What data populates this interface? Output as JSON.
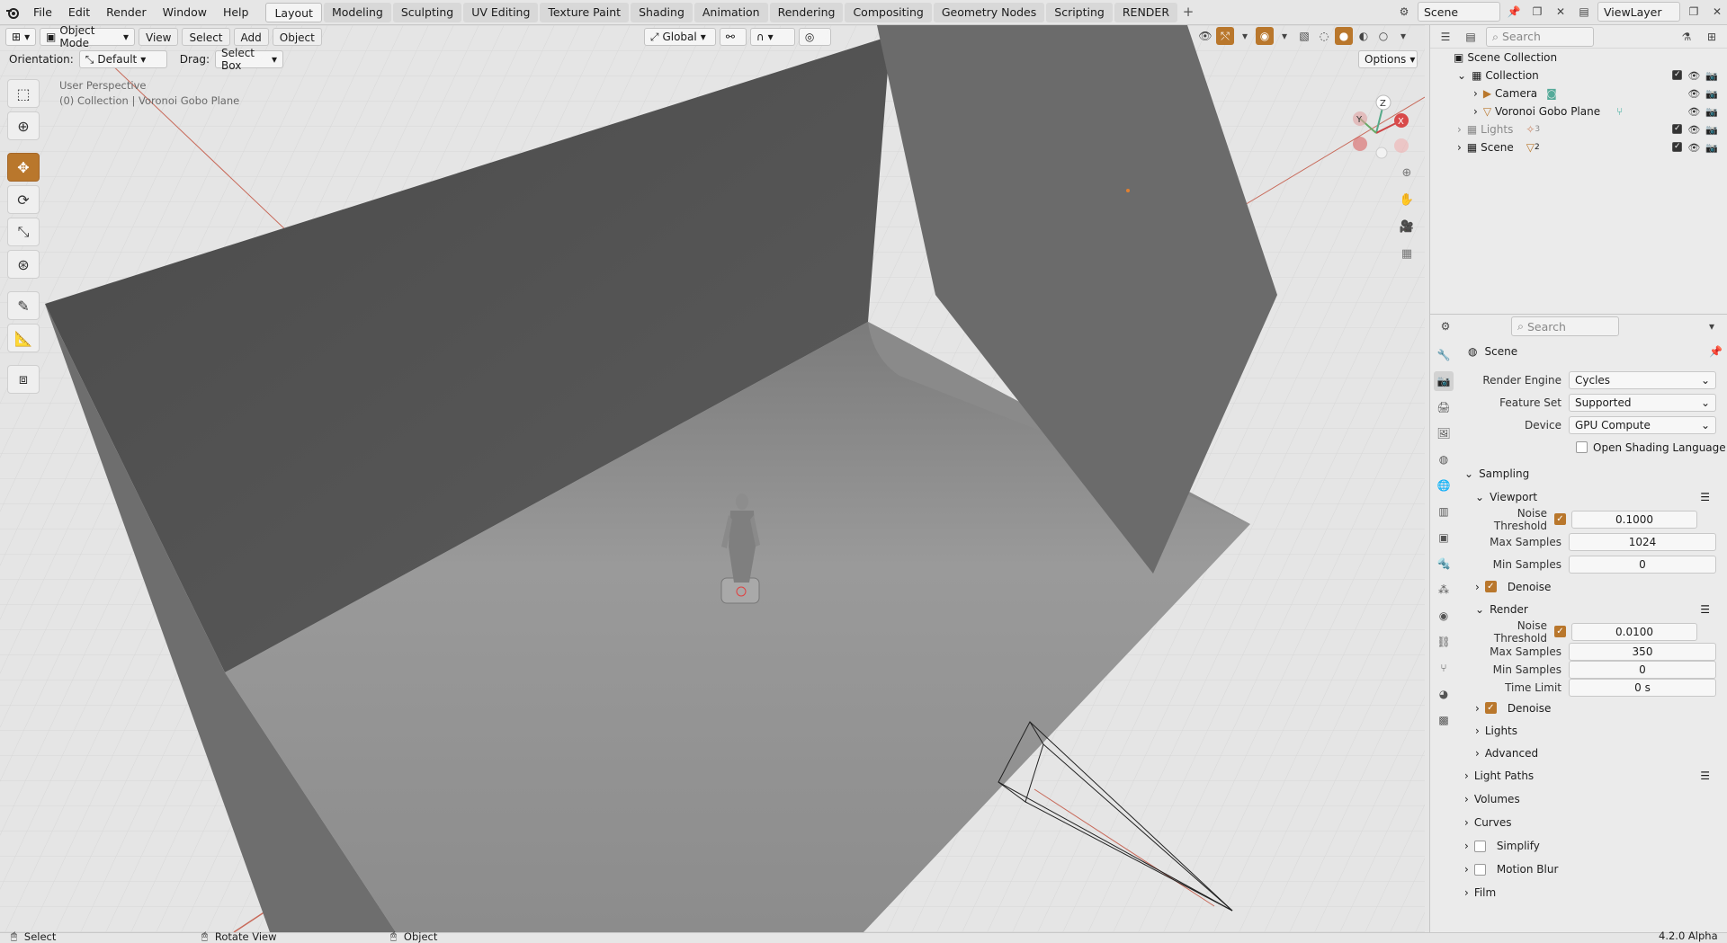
{
  "topbar": {
    "menus": [
      "File",
      "Edit",
      "Render",
      "Window",
      "Help"
    ],
    "workspaces": [
      "Layout",
      "Modeling",
      "Sculpting",
      "UV Editing",
      "Texture Paint",
      "Shading",
      "Animation",
      "Rendering",
      "Compositing",
      "Geometry Nodes",
      "Scripting",
      "RENDER"
    ],
    "active_workspace": "Layout",
    "add_label": "+",
    "scene_name": "Scene",
    "view_layer": "ViewLayer"
  },
  "viewport": {
    "mode": "Object Mode",
    "menus": [
      "View",
      "Select",
      "Add",
      "Object"
    ],
    "transform_orientation": "Global",
    "orientation_label": "Orientation:",
    "orientation_value": "Default",
    "drag_label": "Drag:",
    "drag_value": "Select Box",
    "options_label": "Options",
    "view_name": "User Perspective",
    "context_text": "(0) Collection | Voronoi Gobo Plane",
    "gizmo_axes": {
      "z": "Z",
      "y": "Y",
      "x": "X"
    }
  },
  "outliner": {
    "search_placeholder": "Search",
    "root": "Scene Collection",
    "rows": [
      {
        "label": "Collection",
        "badge": ""
      },
      {
        "label": "Camera",
        "badge": ""
      },
      {
        "label": "Voronoi Gobo Plane",
        "badge": ""
      },
      {
        "label": "Lights",
        "badge": "3"
      },
      {
        "label": "Scene",
        "badge": "2"
      }
    ]
  },
  "properties": {
    "search_placeholder": "Search",
    "context": "Scene",
    "render_engine_label": "Render Engine",
    "render_engine": "Cycles",
    "feature_set_label": "Feature Set",
    "feature_set": "Supported",
    "device_label": "Device",
    "device": "GPU Compute",
    "osl_label": "Open Shading Language",
    "sampling_label": "Sampling",
    "viewport_label": "Viewport",
    "vp_noise_label": "Noise Threshold",
    "vp_noise": "0.1000",
    "vp_max_label": "Max Samples",
    "vp_max": "1024",
    "vp_min_label": "Min Samples",
    "vp_min": "0",
    "denoise_label": "Denoise",
    "render_label": "Render",
    "r_noise_label": "Noise Threshold",
    "r_noise": "0.0100",
    "r_max_label": "Max Samples",
    "r_max": "350",
    "r_min_label": "Min Samples",
    "r_min": "0",
    "time_limit_label": "Time Limit",
    "time_limit": "0 s",
    "lights_label": "Lights",
    "advanced_label": "Advanced",
    "light_paths_label": "Light Paths",
    "volumes_label": "Volumes",
    "curves_label": "Curves",
    "simplify_label": "Simplify",
    "motion_blur_label": "Motion Blur",
    "film_label": "Film"
  },
  "statusbar": {
    "select": "Select",
    "rotate": "Rotate View",
    "object": "Object",
    "version": "4.2.0 Alpha"
  },
  "colors": {
    "accent": "#b9772c"
  }
}
